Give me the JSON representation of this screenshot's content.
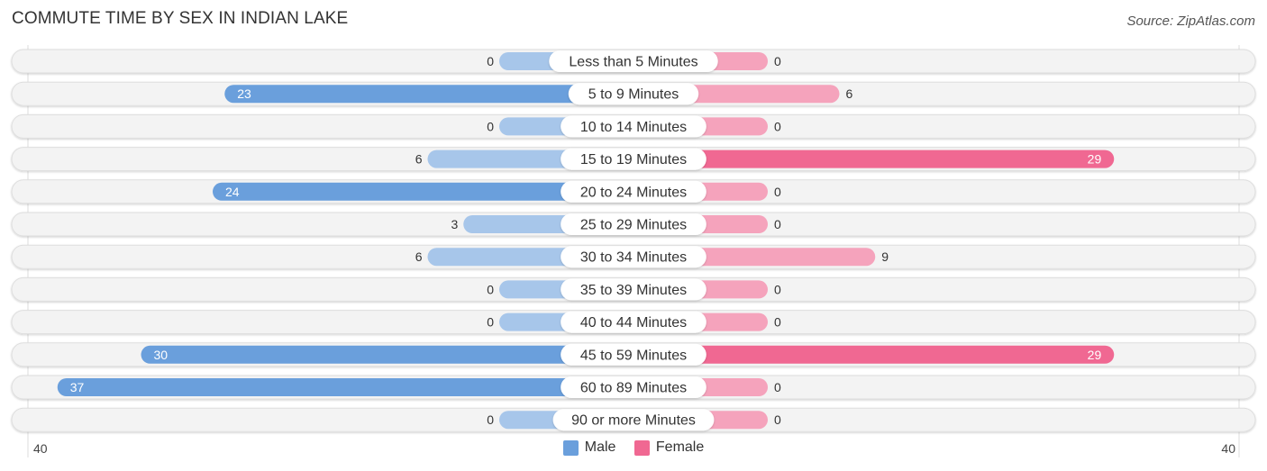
{
  "title": "COMMUTE TIME BY SEX IN INDIAN LAKE",
  "source": "Source: ZipAtlas.com",
  "colors": {
    "male": "#6a9fdc",
    "male_light": "#a7c6ea",
    "female": "#f06892",
    "female_light": "#f5a3bc",
    "track": "#f3f3f3"
  },
  "chart_data": {
    "type": "bar",
    "orientation": "horizontal-diverging",
    "title": "COMMUTE TIME BY SEX IN INDIAN LAKE",
    "categories": [
      "Less than 5 Minutes",
      "5 to 9 Minutes",
      "10 to 14 Minutes",
      "15 to 19 Minutes",
      "20 to 24 Minutes",
      "25 to 29 Minutes",
      "30 to 34 Minutes",
      "35 to 39 Minutes",
      "40 to 44 Minutes",
      "45 to 59 Minutes",
      "60 to 89 Minutes",
      "90 or more Minutes"
    ],
    "series": [
      {
        "name": "Male",
        "values": [
          0,
          23,
          0,
          6,
          24,
          3,
          6,
          0,
          0,
          30,
          37,
          0
        ]
      },
      {
        "name": "Female",
        "values": [
          0,
          6,
          0,
          29,
          0,
          0,
          9,
          0,
          0,
          29,
          0,
          0
        ]
      }
    ],
    "axis": {
      "left_label": "40",
      "right_label": "40",
      "max": 40
    },
    "legend": [
      "Male",
      "Female"
    ],
    "legend_position": "bottom-center"
  }
}
